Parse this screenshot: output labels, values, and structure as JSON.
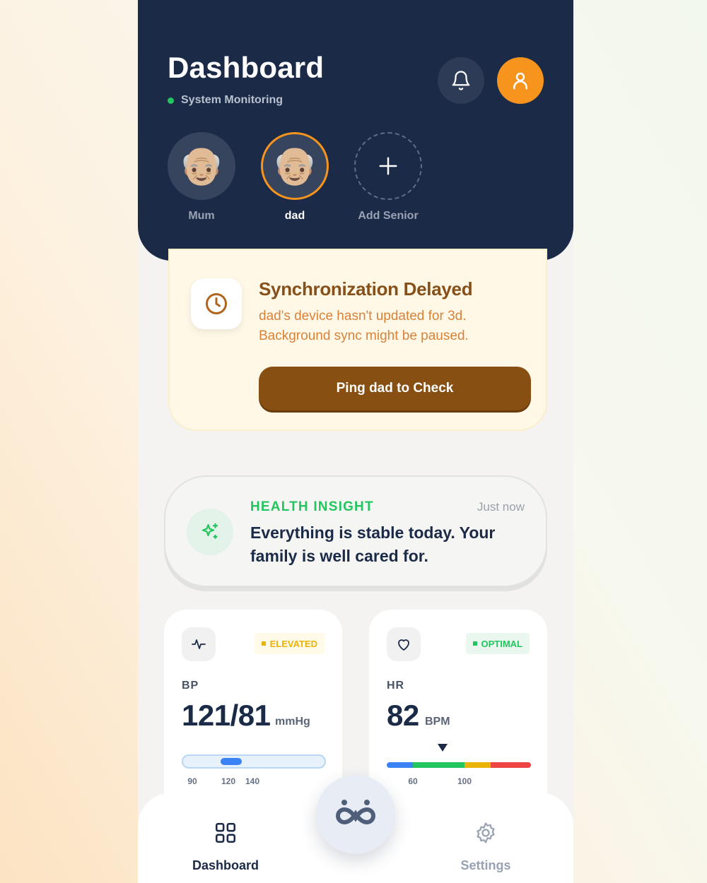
{
  "header": {
    "title": "Dashboard",
    "status_text": "System Monitoring",
    "status_color": "#22c55e",
    "icons": {
      "notifications": "bell-icon",
      "profile": "user-icon"
    }
  },
  "seniors": [
    {
      "name": "Mum",
      "avatar": "👴🏼",
      "selected": false
    },
    {
      "name": "dad",
      "avatar": "👴🏼",
      "selected": true
    },
    {
      "name": "Add Senior",
      "icon": "plus-icon"
    }
  ],
  "sync_alert": {
    "title": "Synchronization Delayed",
    "message": "dad's device hasn't updated for 3d. Background sync might be paused.",
    "button_label": "Ping dad to Check",
    "icon": "clock-icon"
  },
  "insight": {
    "label": "HEALTH INSIGHT",
    "time": "Just now",
    "message": "Everything is stable today. Your family is well cared for.",
    "icon": "sparkles-icon"
  },
  "metrics": {
    "bp": {
      "label": "BP",
      "value": "121/81",
      "unit": "mmHg",
      "badge": "ELEVATED",
      "icon": "activity-icon",
      "ticks": [
        "90",
        "120",
        "140"
      ]
    },
    "hr": {
      "label": "HR",
      "value": "82",
      "unit": "BPM",
      "badge": "OPTIMAL",
      "icon": "heart-icon",
      "ticks": [
        "60",
        "100"
      ]
    }
  },
  "colors": {
    "navy": "#1b2a47",
    "orange": "#f7941d",
    "brown": "#874f12",
    "green": "#22c55e",
    "blue": "#3b82f6",
    "yellow": "#eab308",
    "red": "#ef4444"
  },
  "bottom_nav": {
    "dashboard_label": "Dashboard",
    "settings_label": "Settings",
    "center_icon": "infinity-family-icon"
  }
}
